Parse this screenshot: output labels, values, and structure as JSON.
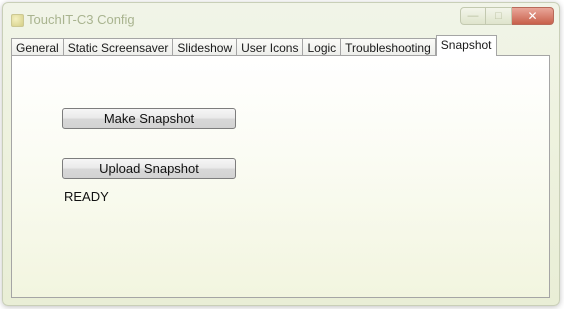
{
  "window": {
    "title": "TouchIT-C3 Config",
    "caption_buttons": {
      "minimize_icon": "minimize-icon",
      "maximize_icon": "maximize-icon",
      "close_icon": "close-icon"
    }
  },
  "tabs": [
    {
      "label": "General",
      "active": false
    },
    {
      "label": "Static Screensaver",
      "active": false
    },
    {
      "label": "Slideshow",
      "active": false
    },
    {
      "label": "User Icons",
      "active": false
    },
    {
      "label": "Logic",
      "active": false
    },
    {
      "label": "Troubleshooting",
      "active": false
    },
    {
      "label": "Snapshot",
      "active": true
    }
  ],
  "snapshot": {
    "make_label": "Make Snapshot",
    "upload_label": "Upload Snapshot",
    "status": "READY"
  },
  "colors": {
    "close_button": "#c8604b",
    "title_text": "#a9b48f"
  }
}
